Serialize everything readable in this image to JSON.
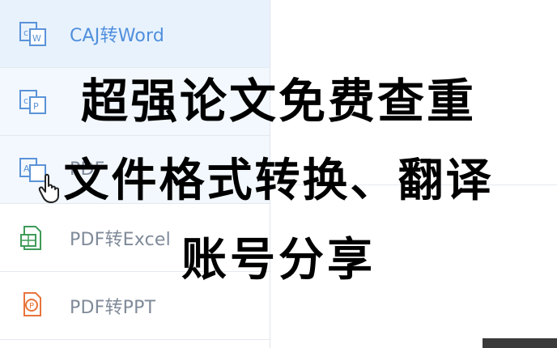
{
  "sidebar": {
    "items": [
      {
        "label": "CAJ转Word",
        "icon": "caj-to-word-icon",
        "state": "active"
      },
      {
        "label": "",
        "icon": "caj-to-pdf-icon",
        "state": "soft"
      },
      {
        "label": "PDF",
        "icon": "pdf-to-word-icon",
        "state": "normal"
      },
      {
        "label": "PDF转Excel",
        "icon": "pdf-to-excel-icon",
        "state": "normal"
      },
      {
        "label": "PDF转PPT",
        "icon": "pdf-to-ppt-icon",
        "state": "normal"
      }
    ]
  },
  "overlay": {
    "line1": "超强论文免费查重",
    "line2": "文件格式转换、翻译",
    "line3": "账号分享"
  },
  "colors": {
    "accent": "#4f8fdc",
    "active_bg": "#e8f2fd",
    "muted_text": "#7f8a99",
    "excel_green": "#3f9b58",
    "ppt_orange": "#e8743b"
  }
}
